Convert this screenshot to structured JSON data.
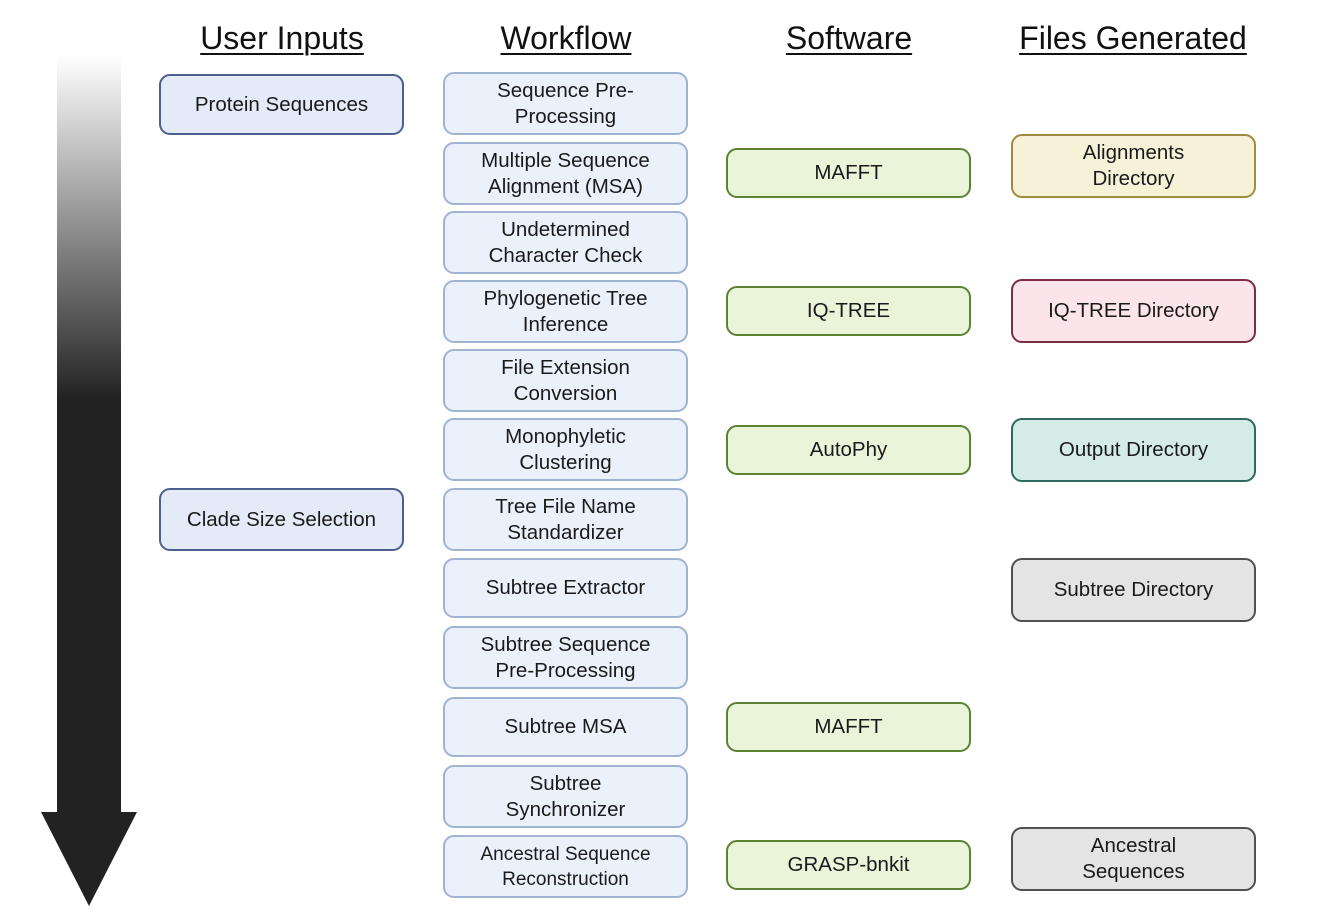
{
  "headers": {
    "user_inputs": "User Inputs",
    "workflow": "Workflow",
    "software": "Software",
    "files_generated": "Files Generated"
  },
  "user_inputs": [
    {
      "label": "Protein Sequences"
    },
    {
      "label": "Clade Size Selection"
    }
  ],
  "workflow": [
    {
      "label": "Sequence Pre-\nProcessing"
    },
    {
      "label": "Multiple Sequence\nAlignment (MSA)"
    },
    {
      "label": "Undetermined\nCharacter Check"
    },
    {
      "label": "Phylogenetic Tree\nInference"
    },
    {
      "label": "File Extension\nConversion"
    },
    {
      "label": "Monophyletic\nClustering"
    },
    {
      "label": "Tree File Name\nStandardizer"
    },
    {
      "label": "Subtree Extractor"
    },
    {
      "label": "Subtree Sequence\nPre-Processing"
    },
    {
      "label": "Subtree MSA"
    },
    {
      "label": "Subtree\nSynchronizer"
    },
    {
      "label": "Ancestral Sequence\nReconstruction"
    }
  ],
  "software": [
    {
      "label": "MAFFT",
      "step": "Multiple Sequence Alignment (MSA)"
    },
    {
      "label": "IQ-TREE",
      "step": "Phylogenetic Tree Inference"
    },
    {
      "label": "AutoPhy",
      "step": "Monophyletic Clustering"
    },
    {
      "label": "MAFFT",
      "step": "Subtree MSA"
    },
    {
      "label": "GRASP-bnkit",
      "step": "Ancestral Sequence Reconstruction"
    }
  ],
  "files_generated": [
    {
      "label": "Alignments\nDirectory",
      "color": "#f5f2d8"
    },
    {
      "label": "IQ-TREE Directory",
      "color": "#fbe4ea"
    },
    {
      "label": "Output Directory",
      "color": "#d5ebe6"
    },
    {
      "label": "Subtree Directory",
      "color": "#e4e4e4"
    },
    {
      "label": "Ancestral\nSequences",
      "color": "#e4e4e4"
    }
  ],
  "colors": {
    "user_input_fill": "#e4eaf8",
    "workflow_fill": "#eaf1fb",
    "software_fill": "#e9f4d9",
    "arrow_dark": "#222222"
  }
}
